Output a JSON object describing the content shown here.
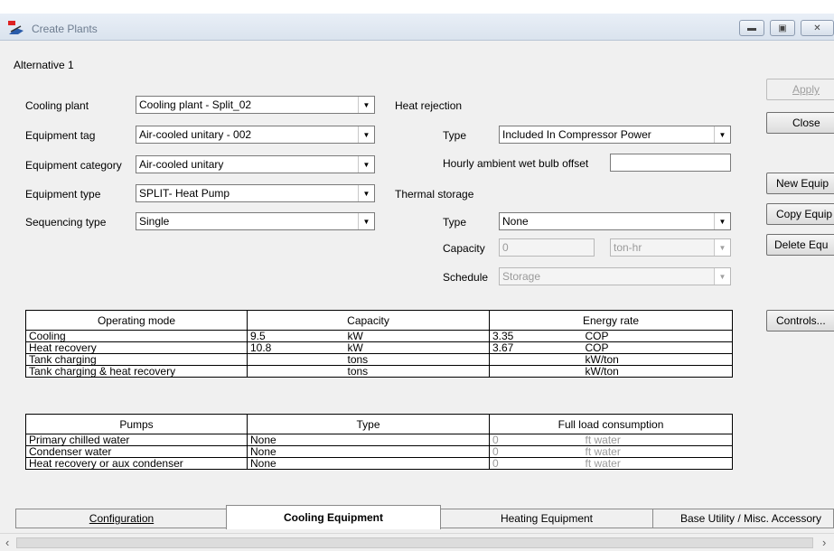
{
  "window": {
    "title": "Create Plants",
    "icon": "app-icon",
    "controls": [
      "minimize-icon",
      "maximize-icon",
      "close-icon"
    ]
  },
  "alternative_label": "Alternative 1",
  "left_fields": {
    "cooling_plant": {
      "label": "Cooling plant",
      "value": "Cooling plant - Split_02"
    },
    "equipment_tag": {
      "label": "Equipment tag",
      "value": "Air-cooled unitary - 002"
    },
    "equipment_category": {
      "label": "Equipment category",
      "value": "Air-cooled unitary"
    },
    "equipment_type": {
      "label": "Equipment type",
      "value": "SPLIT-  Heat Pump"
    },
    "sequencing_type": {
      "label": "Sequencing type",
      "value": "Single"
    }
  },
  "heat_rejection": {
    "heading": "Heat rejection",
    "type_label": "Type",
    "type_value": "Included In Compressor Power",
    "offset_label": "Hourly ambient wet bulb offset",
    "offset_value": ""
  },
  "thermal_storage": {
    "heading": "Thermal storage",
    "type_label": "Type",
    "type_value": "None",
    "capacity_label": "Capacity",
    "capacity_value": "0",
    "capacity_unit": "ton-hr",
    "schedule_label": "Schedule",
    "schedule_value": "Storage"
  },
  "buttons": {
    "apply": "Apply",
    "close": "Close",
    "new_equip": "New Equip",
    "copy_equip": "Copy Equip",
    "delete_equip": "Delete Equ",
    "controls": "Controls..."
  },
  "operating_table": {
    "headers": [
      "Operating mode",
      "Capacity",
      "Energy rate"
    ],
    "rows": [
      {
        "mode": "Cooling",
        "cap": "9.5",
        "cap_unit": "kW",
        "rate": "3.35",
        "rate_unit": "COP"
      },
      {
        "mode": "Heat recovery",
        "cap": "10.8",
        "cap_unit": "kW",
        "rate": "3.67",
        "rate_unit": "COP"
      },
      {
        "mode": "Tank charging",
        "cap": "",
        "cap_unit": "tons",
        "rate": "",
        "rate_unit": "kW/ton"
      },
      {
        "mode": "Tank charging & heat recovery",
        "cap": "",
        "cap_unit": "tons",
        "rate": "",
        "rate_unit": "kW/ton"
      }
    ]
  },
  "pumps_table": {
    "headers": [
      "Pumps",
      "Type",
      "Full load consumption"
    ],
    "rows": [
      {
        "pump": "Primary chilled water",
        "type": "None",
        "value": "0",
        "unit": "ft water"
      },
      {
        "pump": "Condenser water",
        "type": "None",
        "value": "0",
        "unit": "ft water"
      },
      {
        "pump": "Heat recovery or aux condenser",
        "type": "None",
        "value": "0",
        "unit": "ft water"
      }
    ]
  },
  "tabs": [
    {
      "label": "Configuration",
      "active": false
    },
    {
      "label": "Cooling Equipment",
      "active": true
    },
    {
      "label": "Heating Equipment",
      "active": false
    },
    {
      "label": "Base Utility / Misc. Accessory",
      "active": false
    }
  ]
}
